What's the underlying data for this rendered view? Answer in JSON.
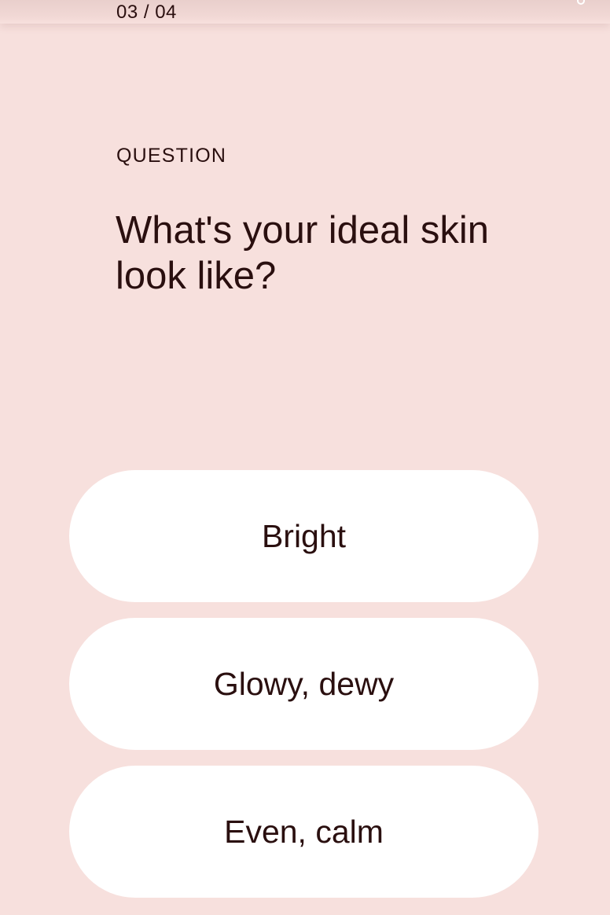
{
  "progress": {
    "counter": "03 / 04"
  },
  "question": {
    "eyebrow": "QUESTION",
    "text": "What's your ideal skin look like?"
  },
  "answers": [
    {
      "label": "Bright"
    },
    {
      "label": "Glowy, dewy"
    },
    {
      "label": "Even, calm"
    }
  ],
  "icons": {
    "top_right": "partial-icon"
  },
  "colors": {
    "background": "#f7e0dd",
    "text": "#2a0f0f",
    "button": "#ffffff"
  }
}
